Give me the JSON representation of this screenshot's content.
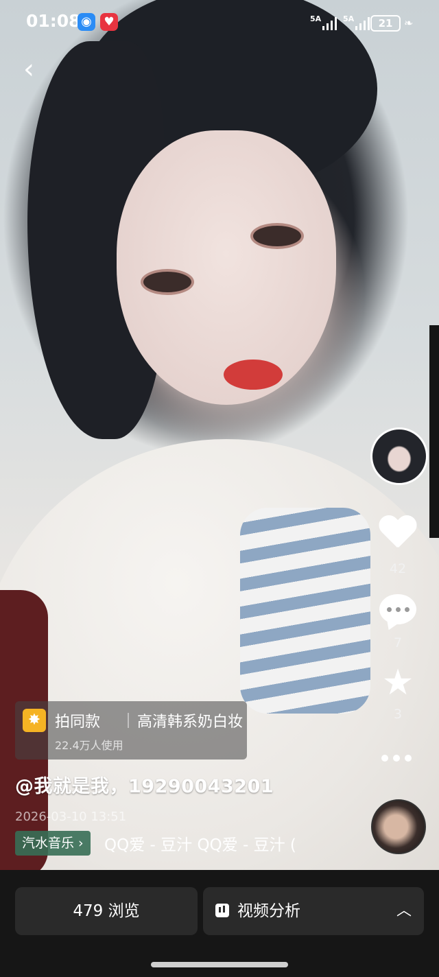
{
  "status_bar": {
    "time": "01:08",
    "signal_1": "5A",
    "signal_2": "5A",
    "battery": "21"
  },
  "effect": {
    "title": "拍同款",
    "name": "高清韩系奶白妆",
    "users": "22.4万人使用"
  },
  "post": {
    "caption": "@我就是我，19290043201",
    "date": "2026-03-10 13:51"
  },
  "music": {
    "tag": "汽水音乐 ›",
    "title": "QQ爱 - 豆汁  QQ爱 - 豆汁  ("
  },
  "actions": {
    "likes": "42",
    "comments": "7",
    "favorites": "3"
  },
  "bottom_bar": {
    "views": "479 浏览",
    "analysis": "视频分析"
  }
}
